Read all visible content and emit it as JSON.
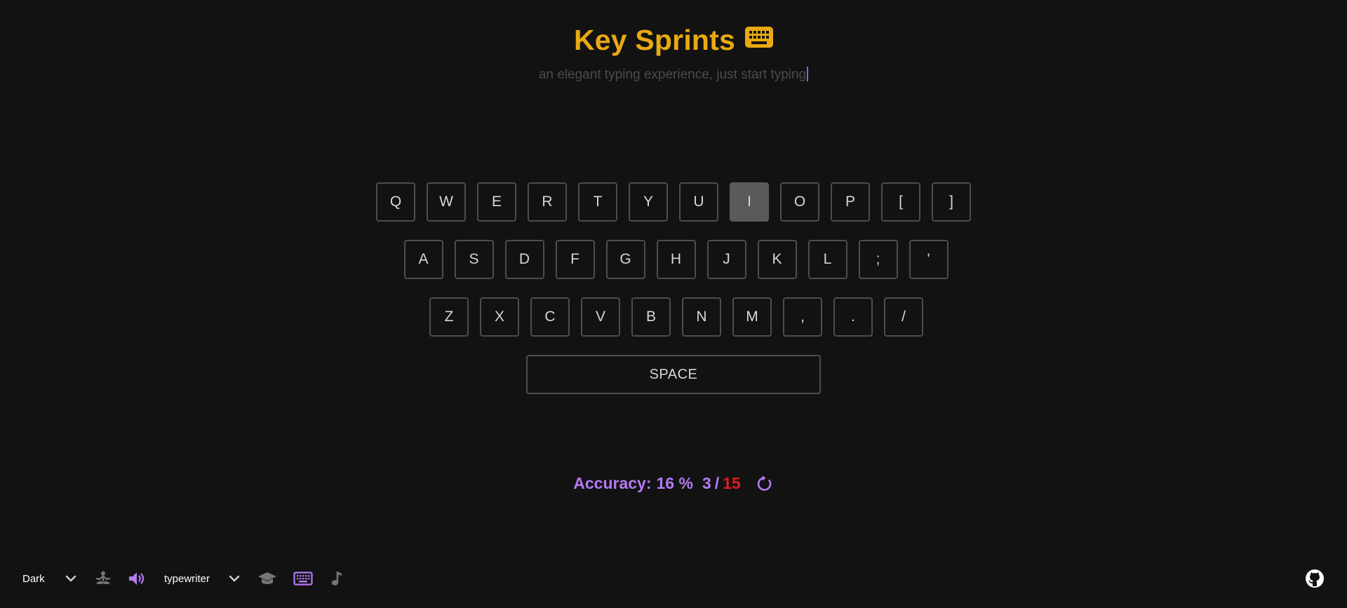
{
  "header": {
    "title": "Key Sprints",
    "subtitle": "an elegant typing experience, just start typing"
  },
  "keyboard": {
    "active_key": "I",
    "rows": [
      [
        "Q",
        "W",
        "E",
        "R",
        "T",
        "Y",
        "U",
        "I",
        "O",
        "P",
        "[",
        "]"
      ],
      [
        "A",
        "S",
        "D",
        "F",
        "G",
        "H",
        "J",
        "K",
        "L",
        ";",
        "'"
      ],
      [
        "Z",
        "X",
        "C",
        "V",
        "B",
        "N",
        "M",
        ",",
        ".",
        "/"
      ]
    ],
    "space_label": "SPACE"
  },
  "stats": {
    "accuracy_label": "Accuracy:",
    "accuracy_value": "16 %",
    "correct": "3",
    "separator": "/",
    "total": "15"
  },
  "footer": {
    "theme_value": "Dark",
    "sound_value": "typewriter"
  },
  "icons": {
    "title": "keyboard-icon",
    "restart": "restart-icon",
    "theme_dropdown": "chevron-down-icon",
    "focus_mode": "meditation-icon",
    "sound": "speaker-icon",
    "sound_dropdown": "chevron-down-icon",
    "learn": "graduation-cap-icon",
    "keyboard_toggle": "keyboard-icon",
    "music": "music-note-icon",
    "github": "github-icon"
  },
  "colors": {
    "background": "#121212",
    "title": "#e8a912",
    "accent": "#b47af5",
    "error": "#e31b1b",
    "key_border": "#4d4d4d",
    "key_active": "#5a5a5a",
    "subtitle": "#4b4b4b",
    "muted_icon": "#777777"
  }
}
